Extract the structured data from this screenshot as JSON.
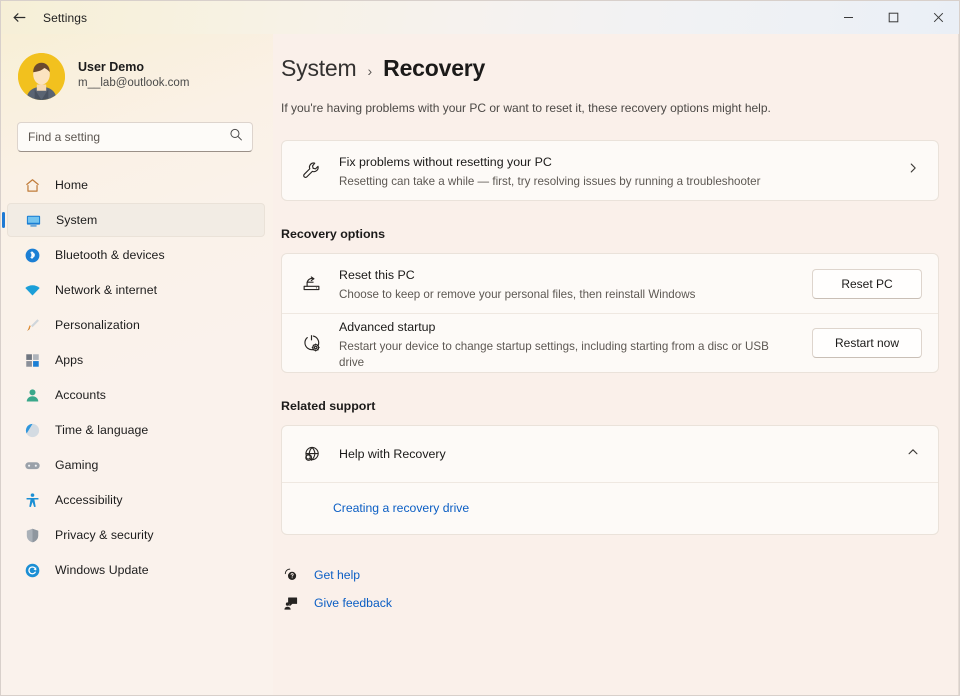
{
  "window": {
    "title": "Settings",
    "back_icon": "back-arrow-icon",
    "minimize_label": "─",
    "maximize_label": "□",
    "close_label": "✕"
  },
  "account": {
    "name": "User Demo",
    "email": "m__lab@outlook.com",
    "avatar_icon": "user-avatar-icon",
    "avatar_color": "#f2c11e"
  },
  "search": {
    "placeholder": "Find a setting",
    "value": "",
    "icon": "search-icon"
  },
  "sidebar": {
    "accent_color": "#1f7ad4",
    "items": [
      {
        "label": "Home",
        "icon": "home-icon",
        "selected": false
      },
      {
        "label": "System",
        "icon": "monitor-icon",
        "selected": true
      },
      {
        "label": "Bluetooth & devices",
        "icon": "bluetooth-icon",
        "selected": false
      },
      {
        "label": "Network & internet",
        "icon": "wifi-icon",
        "selected": false
      },
      {
        "label": "Personalization",
        "icon": "paintbrush-icon",
        "selected": false
      },
      {
        "label": "Apps",
        "icon": "apps-grid-icon",
        "selected": false
      },
      {
        "label": "Accounts",
        "icon": "person-icon",
        "selected": false
      },
      {
        "label": "Time & language",
        "icon": "clock-globe-icon",
        "selected": false
      },
      {
        "label": "Gaming",
        "icon": "gamepad-icon",
        "selected": false
      },
      {
        "label": "Accessibility",
        "icon": "accessibility-icon",
        "selected": false
      },
      {
        "label": "Privacy & security",
        "icon": "shield-icon",
        "selected": false
      },
      {
        "label": "Windows Update",
        "icon": "update-refresh-icon",
        "selected": false
      }
    ]
  },
  "main": {
    "breadcrumb": {
      "parent": "System",
      "separator": "›",
      "current": "Recovery"
    },
    "description": "If you're having problems with your PC or want to reset it, these recovery options might help.",
    "troubleshoot_card": {
      "icon": "wrench-icon",
      "title": "Fix problems without resetting your PC",
      "subtitle": "Resetting can take a while — first, try resolving issues by running a troubleshooter",
      "chevron": "chevron-right-icon"
    },
    "recovery_options": {
      "heading": "Recovery options",
      "rows": [
        {
          "icon": "reset-pc-icon",
          "title": "Reset this PC",
          "subtitle": "Choose to keep or remove your personal files, then reinstall Windows",
          "button": "Reset PC"
        },
        {
          "icon": "power-gear-icon",
          "title": "Advanced startup",
          "subtitle": "Restart your device to change startup settings, including starting from a disc or USB drive",
          "button": "Restart now"
        }
      ]
    },
    "related_support": {
      "heading": "Related support",
      "expander": {
        "icon": "globe-search-icon",
        "title": "Help with Recovery",
        "chevron": "chevron-up-icon",
        "expanded": true,
        "links": [
          {
            "label": "Creating a recovery drive"
          }
        ]
      }
    },
    "footer_links": [
      {
        "label": "Get help",
        "icon": "help-question-icon"
      },
      {
        "label": "Give feedback",
        "icon": "feedback-icon"
      }
    ],
    "link_color": "#0b5ec4"
  }
}
